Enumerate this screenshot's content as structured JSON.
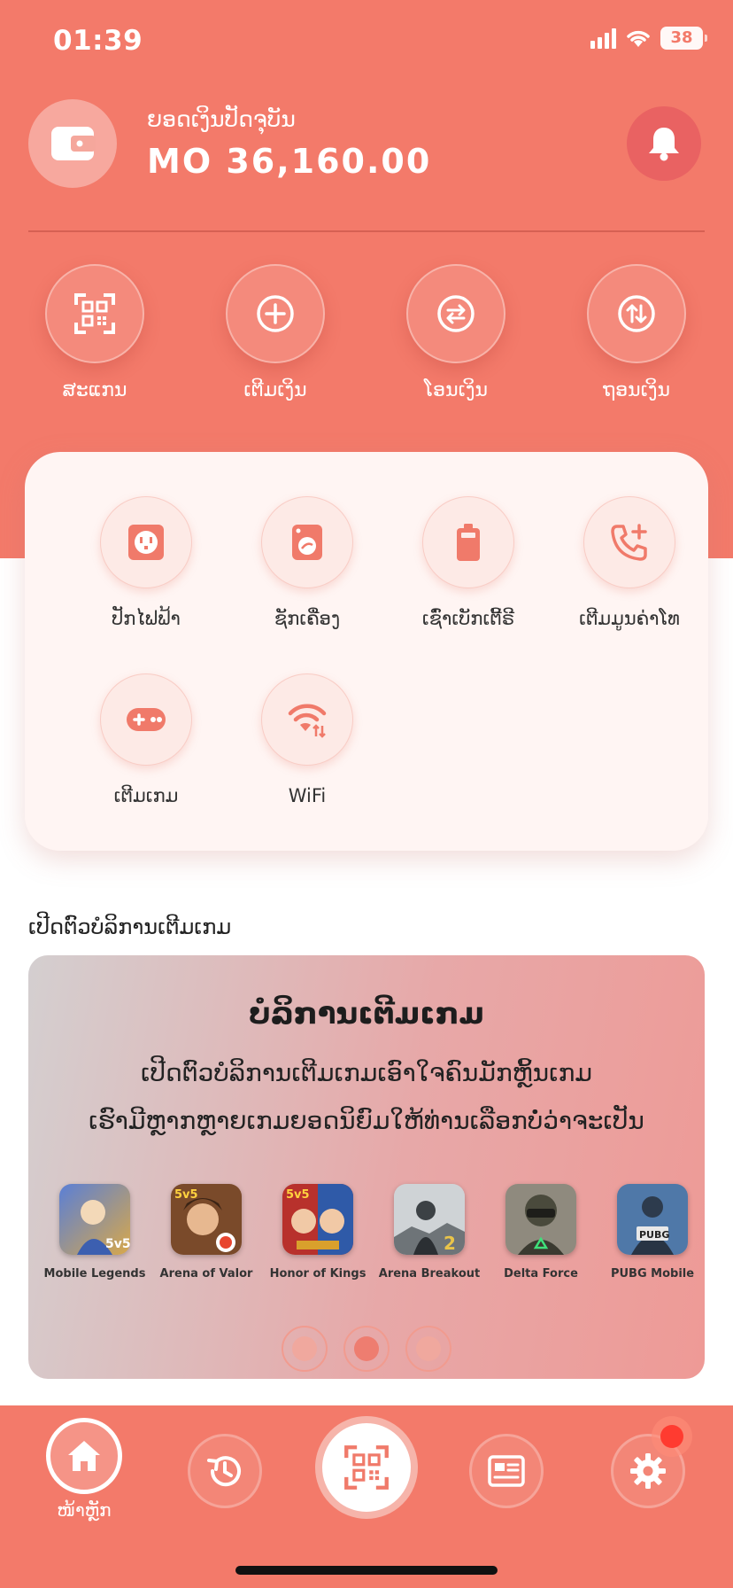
{
  "status_bar": {
    "time": "01:39",
    "battery": "38"
  },
  "balance": {
    "label": "ຍອດເງິນປັດຈຸບັນ",
    "value": "MO 36,160.00"
  },
  "quick_actions": [
    {
      "label": "ສະແກນ",
      "icon": "qr-scan-icon"
    },
    {
      "label": "ເຕີມເງິນ",
      "icon": "plus-circle-icon"
    },
    {
      "label": "ໂອນເງິນ",
      "icon": "transfer-icon"
    },
    {
      "label": "ຖອນເງິນ",
      "icon": "withdraw-icon"
    }
  ],
  "services": [
    {
      "label": "ປັກໄຟຟ້າ",
      "icon": "power-outlet-icon"
    },
    {
      "label": "ຊັກເຄື່ອງ",
      "icon": "washing-machine-icon"
    },
    {
      "label": "ເຊົ່າເບັກເຕີ້ຣີ",
      "icon": "battery-icon"
    },
    {
      "label": "ເຕີມມູນຄ່າໂທ",
      "icon": "phone-add-icon"
    },
    {
      "label": "ເຕີມເກມ",
      "icon": "gamepad-icon"
    },
    {
      "label": "WiFi",
      "icon": "wifi-icon"
    }
  ],
  "section_title": "ເປີດຕົວບໍລິການເຕີມເກມ",
  "banner": {
    "title": "ບໍລິການເຕີມເກມ",
    "line1": "ເປີດຕົວບໍລິການເຕີມເກມເອົາໃຈຄົນມັກຫຼິ້ນເກມ",
    "line2": "ເຮົາມີຫຼາກຫຼາຍເກມຍອດນິຍົມໃຫ້ທ່ານເລືອກບໍ່ວ່າຈະເປັນ",
    "games": [
      {
        "name": "Mobile Legends"
      },
      {
        "name": "Arena of Valor"
      },
      {
        "name": "Honor of Kings"
      },
      {
        "name": "Arena Breakout"
      },
      {
        "name": "Delta Force"
      },
      {
        "name": "PUBG Mobile"
      }
    ],
    "page_count": 3,
    "active_page": 2
  },
  "bottom_nav": {
    "home_label": "ໜ້າຫຼັກ"
  },
  "colors": {
    "primary": "#f37a6a",
    "card": "#fff5f3",
    "accent": "#ee7d70"
  }
}
